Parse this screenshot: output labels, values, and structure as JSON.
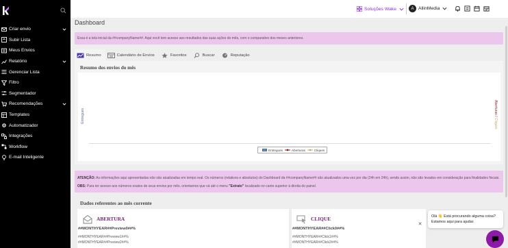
{
  "sidebar": {
    "items": [
      {
        "label": "Criar envio",
        "icon": "envelope-icon",
        "chevron": true
      },
      {
        "label": "Subir Lista",
        "icon": "upload-icon",
        "chevron": false
      },
      {
        "label": "Meus Envios",
        "icon": "mail-list-icon",
        "chevron": false
      },
      {
        "label": "Relatório",
        "icon": "report-icon",
        "chevron": true
      },
      {
        "label": "Gerenciar Lista",
        "icon": "list-icon",
        "chevron": false
      },
      {
        "label": "Filtro",
        "icon": "filter-icon",
        "chevron": false
      },
      {
        "label": "Segmentador",
        "icon": "segment-icon",
        "chevron": false
      },
      {
        "label": "Recomendações",
        "icon": "cart-icon",
        "chevron": true
      },
      {
        "label": "Templates",
        "icon": "template-icon",
        "chevron": false
      },
      {
        "label": "Automatizador",
        "icon": "gear-icon",
        "chevron": false
      },
      {
        "label": "Integrações",
        "icon": "integration-icon",
        "chevron": false
      },
      {
        "label": "Workflow",
        "icon": "workflow-icon",
        "chevron": false
      },
      {
        "label": "E-mail Inteligente",
        "icon": "lightbulb-icon",
        "chevron": false
      }
    ]
  },
  "topbar": {
    "solutions_label": "Soluções Wake",
    "account_initial": "A",
    "account_name": "AllinMedia"
  },
  "main": {
    "page_title": "Dashboard",
    "info_alert": "Essa é a tela inicial da ##companyName##. Aqui você tem acesso aos resultados das suas ações do mês, com o comparativo dos meses anteriores.",
    "tabs": [
      {
        "label": "Resumo",
        "active": true
      },
      {
        "label": "Calendário de Envios",
        "active": false
      },
      {
        "label": "Favoritos",
        "active": false
      },
      {
        "label": "Buscar",
        "active": false
      },
      {
        "label": "Reputação",
        "active": false
      }
    ],
    "summary_title": "Resumo dos envios do mês",
    "warning": {
      "label1": "ATENÇÃO:",
      "text1": "As informações aqui apresentadas não são atualizadas em tempo real. Os números (relativos e absolutos) do Dashboard da ##companyName## são atualizados uma vez por dia (24h em 24h), sendo assim, não são levados em consideração para finalidades fiscais.",
      "label2": "OBS:",
      "text2a": "Para ter acesso aos números exatos de seus envios por mês, orientamos que vá até o menu",
      "text2b": "\"Extrato\"",
      "text2c": "localizado no canto superior à direita do painel."
    },
    "month_title": "Dados referentes ao mês corrente",
    "cards": [
      {
        "title": "ABERTURA",
        "headline": "##MONTHYEAR##Preview0##%",
        "line1": "##MONTHYEAR##Preview1##%",
        "line2": "##MONTHYEAR##Preview2##%"
      },
      {
        "title": "CLIQUE",
        "headline": "##MONTHYEAR##Click0##%",
        "line1": "##MONTHYEAR##Click1##%",
        "line2": "##MONTHYEAR##Click2##%"
      }
    ]
  },
  "chart_data": {
    "type": "bar",
    "title": "",
    "ylabel_left": "Entregues",
    "ylabel_right_a": "Aberturas",
    "ylabel_right_sep": " / ",
    "ylabel_right_b": "Cliques",
    "series": [
      {
        "name": "Entregues",
        "values": []
      },
      {
        "name": "Aberturas",
        "values": []
      },
      {
        "name": "Cliques",
        "values": []
      }
    ],
    "categories": [],
    "legend_position": "bottom"
  },
  "chat": {
    "message": "Olá 👋 Está procurando alguma coisa? Estamos aqui para ajudar."
  },
  "colors": {
    "accent": "#8a2be2",
    "alert_bg": "#ecc6ec",
    "chat_button": "#8e1aa8",
    "series_entregues": "#6f8cc2",
    "series_aberturas": "#8b1a1a",
    "series_cliques": "#c9a86a"
  }
}
